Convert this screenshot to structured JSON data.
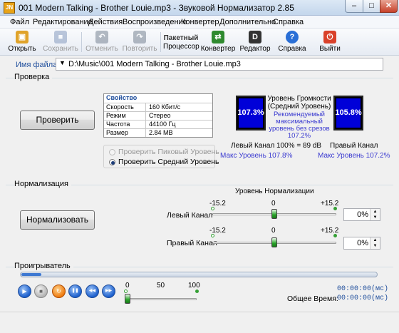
{
  "window": {
    "app_icon_text": "JN",
    "title": "001 Modern Talking - Brother Louie.mp3 - Звуковой Нормализатор 2.85",
    "min": "–",
    "max": "□",
    "close": "✕"
  },
  "menu": [
    "Файл",
    "Редактирование",
    "Действия",
    "Воспроизведение",
    "Конвертер",
    "Дополнительно",
    "Справка"
  ],
  "toolbar": [
    {
      "label": "Открыть",
      "icon": "folder-open-icon",
      "glyph": "▣",
      "color": "#e0a32a",
      "enabled": true
    },
    {
      "label": "Сохранить",
      "icon": "save-icon",
      "glyph": "■",
      "color": "#6f88b3",
      "enabled": false
    },
    {
      "label": "Отменить",
      "icon": "undo-icon",
      "glyph": "↶",
      "color": "#5d6b7d",
      "enabled": false
    },
    {
      "label": "Повторить",
      "icon": "redo-icon",
      "glyph": "↷",
      "color": "#5d6b7d",
      "enabled": false
    },
    {
      "label": "Пакетный Процессор",
      "label1": "Пакетный",
      "label2": "Процессор",
      "icon": "batch-processor-icon",
      "glyph": "▦",
      "color": "#8aa0c0",
      "enabled": true
    },
    {
      "label": "Конвертер",
      "icon": "converter-icon",
      "glyph": "⇄",
      "color": "#2f8a2f",
      "enabled": true
    },
    {
      "label": "Редактор",
      "icon": "editor-icon",
      "glyph": "D",
      "color": "#333333",
      "enabled": true
    },
    {
      "label": "Справка",
      "icon": "help-icon",
      "glyph": "?",
      "color": "#2a6fd6",
      "enabled": true
    },
    {
      "label": "Выйти",
      "icon": "exit-icon",
      "glyph": "⏻",
      "color": "#d9412a",
      "enabled": true
    }
  ],
  "file": {
    "label": "Имя файла:",
    "arrow": "▼",
    "path": "D:\\Music\\001 Modern Talking - Brother Louie.mp3"
  },
  "check": {
    "group_title": "Проверка",
    "button": "Проверить",
    "props_header": "Свойство",
    "props": [
      {
        "k": "Скорость",
        "v": "160 Кбит/с"
      },
      {
        "k": "Режим",
        "v": "Стерео"
      },
      {
        "k": "Частота",
        "v": "44100 Гц"
      },
      {
        "k": "Размер",
        "v": "2.84 MB"
      }
    ],
    "radio_peak": "Проверить Пиковый Уровень",
    "radio_avg": "Проверить Средний Уровень",
    "level_title1": "Уровень Громкости",
    "level_title2": "(Средний Уровень)",
    "recommend": [
      "Рекомендуемый",
      "максимальный",
      "уровень без срезов",
      "107.2%"
    ],
    "left_meter": "107.3%",
    "right_meter": "105.8%",
    "left_label": "Левый Канал",
    "right_label": "Правый Канал",
    "db_text": "100% = 89 dB",
    "left_max": "Макс Уровень 107.8%",
    "right_max": "Макс Уровень 107.2%"
  },
  "normalize": {
    "group_title": "Нормализация",
    "button": "Нормализовать",
    "level_title": "Уровень Нормализации",
    "min": "-15.2",
    "zero": "0",
    "max": "+15.2",
    "left_label": "Левый Канал",
    "right_label": "Правый Канал",
    "left_value": "0%",
    "right_value": "0%",
    "left_level": 0,
    "right_level": 0
  },
  "player": {
    "group_title": "Проигрыватель",
    "buttons": [
      {
        "name": "play-icon",
        "glyph": "▶"
      },
      {
        "name": "stop-icon",
        "glyph": "■"
      },
      {
        "name": "loop-icon",
        "glyph": "↻"
      },
      {
        "name": "pause-icon",
        "glyph": "❚❚"
      },
      {
        "name": "previous-icon",
        "glyph": "◀◀"
      },
      {
        "name": "next-icon",
        "glyph": "▶▶"
      }
    ],
    "vol_0": "0",
    "vol_50": "50",
    "vol_100": "100",
    "time_current": "00:00:00(мс)",
    "total_label": "Общее Время:",
    "time_total": "00:00:00(мс)"
  },
  "colors": {
    "accent": "#1f4e9c",
    "meter_fill": "#0000d8",
    "slider_thumb": "#27a327"
  }
}
